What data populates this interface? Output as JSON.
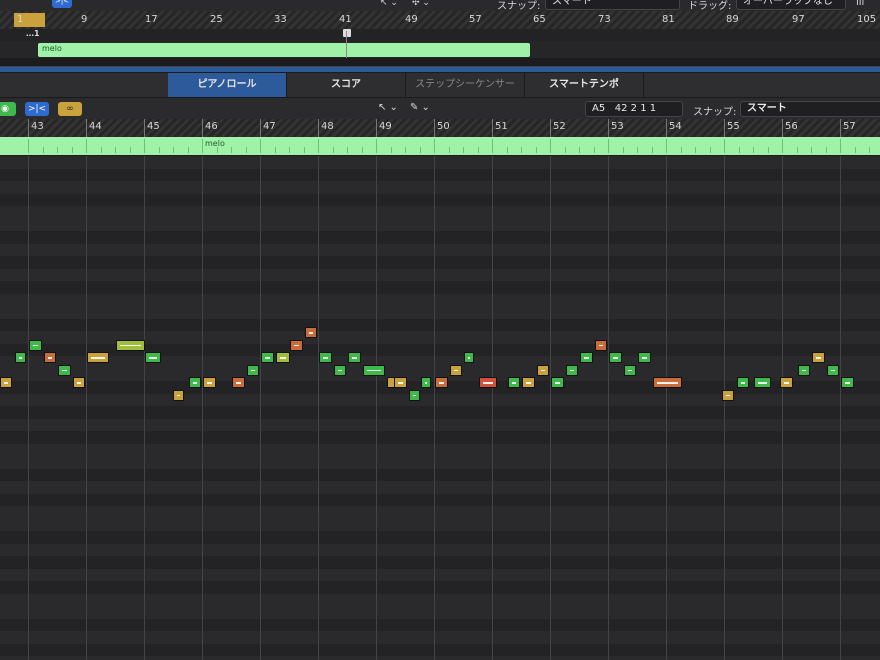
{
  "top": {
    "snap_label": "スナップ:",
    "snap_value": "スマート",
    "drag_label": "ドラッグ:",
    "drag_value": "オーバーラップなし",
    "ruler_numbers": [
      "1",
      "9",
      "17",
      "25",
      "33",
      "41",
      "49",
      "57",
      "65",
      "73",
      "81",
      "89",
      "97",
      "105"
    ],
    "locator_label": "…1",
    "region_name": "melo"
  },
  "tabs": [
    "ピアノロール",
    "スコア",
    "ステップシーケンサー",
    "スマートテンポ"
  ],
  "active_tab": "ピアノロール",
  "toolbar": {
    "position_note": "A5",
    "position_value": "42 2 1 1",
    "snap_label": "スナップ:",
    "snap_value": "スマート"
  },
  "ruler": {
    "bars": [
      "43",
      "44",
      "45",
      "46",
      "47",
      "48",
      "49",
      "50",
      "51",
      "52",
      "53",
      "54",
      "55",
      "56",
      "57"
    ]
  },
  "region": {
    "name": "melo"
  },
  "colors": {
    "green": "#3fb84c",
    "orange": "#c96c3c",
    "gold": "#c9a23c",
    "lime": "#9fbf3c",
    "red": "#d0503c",
    "region": "#9ff2a8",
    "accent_blue": "#2d5a9a"
  },
  "notes": [
    {
      "c": "gold",
      "r": 8,
      "s": 0.0,
      "len": 0.2
    },
    {
      "c": "green",
      "r": 6,
      "s": 0.25,
      "len": 0.2
    },
    {
      "c": "green",
      "r": 5,
      "s": 0.5,
      "len": 0.22
    },
    {
      "c": "orange",
      "r": 6,
      "s": 0.75,
      "len": 0.22
    },
    {
      "c": "green",
      "r": 7,
      "s": 1.0,
      "len": 0.22
    },
    {
      "c": "gold",
      "r": 8,
      "s": 1.25,
      "len": 0.22
    },
    {
      "c": "gold",
      "r": 6,
      "s": 1.5,
      "len": 0.38
    },
    {
      "c": "lime",
      "r": 5,
      "s": 2.0,
      "len": 0.5
    },
    {
      "c": "green",
      "r": 6,
      "s": 2.5,
      "len": 0.28
    },
    {
      "c": "gold",
      "r": 9,
      "s": 2.98,
      "len": 0.2
    },
    {
      "c": "green",
      "r": 8,
      "s": 3.25,
      "len": 0.22
    },
    {
      "c": "gold",
      "r": 8,
      "s": 3.5,
      "len": 0.22
    },
    {
      "c": "orange",
      "r": 8,
      "s": 4.0,
      "len": 0.22
    },
    {
      "c": "green",
      "r": 7,
      "s": 4.25,
      "len": 0.22
    },
    {
      "c": "green",
      "r": 6,
      "s": 4.5,
      "len": 0.22
    },
    {
      "c": "lime",
      "r": 6,
      "s": 4.75,
      "len": 0.25
    },
    {
      "c": "orange",
      "r": 5,
      "s": 5.0,
      "len": 0.22
    },
    {
      "c": "orange",
      "r": 4,
      "s": 5.25,
      "len": 0.22
    },
    {
      "c": "green",
      "r": 6,
      "s": 5.5,
      "len": 0.22
    },
    {
      "c": "green",
      "r": 7,
      "s": 5.75,
      "len": 0.22
    },
    {
      "c": "green",
      "r": 6,
      "s": 6.0,
      "len": 0.22
    },
    {
      "c": "green",
      "r": 7,
      "s": 6.25,
      "len": 0.38
    },
    {
      "c": "gold",
      "r": 8,
      "s": 6.68,
      "len": 0.08
    },
    {
      "c": "gold",
      "r": 8,
      "s": 6.8,
      "len": 0.22
    },
    {
      "c": "green",
      "r": 9,
      "s": 7.05,
      "len": 0.2
    },
    {
      "c": "green",
      "r": 8,
      "s": 7.25,
      "len": 0.18
    },
    {
      "c": "orange",
      "r": 8,
      "s": 7.5,
      "len": 0.22
    },
    {
      "c": "gold",
      "r": 7,
      "s": 7.75,
      "len": 0.22
    },
    {
      "c": "green",
      "r": 6,
      "s": 8.0,
      "len": 0.18
    },
    {
      "c": "red",
      "r": 8,
      "s": 8.25,
      "len": 0.32
    },
    {
      "c": "green",
      "r": 8,
      "s": 8.75,
      "len": 0.22
    },
    {
      "c": "gold",
      "r": 8,
      "s": 9.0,
      "len": 0.22
    },
    {
      "c": "gold",
      "r": 7,
      "s": 9.25,
      "len": 0.22
    },
    {
      "c": "green",
      "r": 8,
      "s": 9.5,
      "len": 0.22
    },
    {
      "c": "green",
      "r": 7,
      "s": 9.75,
      "len": 0.22
    },
    {
      "c": "green",
      "r": 6,
      "s": 10.0,
      "len": 0.22
    },
    {
      "c": "orange",
      "r": 5,
      "s": 10.25,
      "len": 0.22
    },
    {
      "c": "green",
      "r": 6,
      "s": 10.5,
      "len": 0.22
    },
    {
      "c": "green",
      "r": 7,
      "s": 10.75,
      "len": 0.22
    },
    {
      "c": "green",
      "r": 6,
      "s": 11.0,
      "len": 0.22
    },
    {
      "c": "orange",
      "r": 8,
      "s": 11.25,
      "len": 0.5
    },
    {
      "c": "gold",
      "r": 9,
      "s": 12.45,
      "len": 0.2
    },
    {
      "c": "green",
      "r": 8,
      "s": 12.7,
      "len": 0.22
    },
    {
      "c": "green",
      "r": 8,
      "s": 13.0,
      "len": 0.3
    },
    {
      "c": "gold",
      "r": 8,
      "s": 13.45,
      "len": 0.22
    },
    {
      "c": "green",
      "r": 7,
      "s": 13.75,
      "len": 0.22
    },
    {
      "c": "gold",
      "r": 6,
      "s": 14.0,
      "len": 0.22
    },
    {
      "c": "green",
      "r": 7,
      "s": 14.25,
      "len": 0.22
    },
    {
      "c": "green",
      "r": 8,
      "s": 14.5,
      "len": 0.22
    }
  ]
}
